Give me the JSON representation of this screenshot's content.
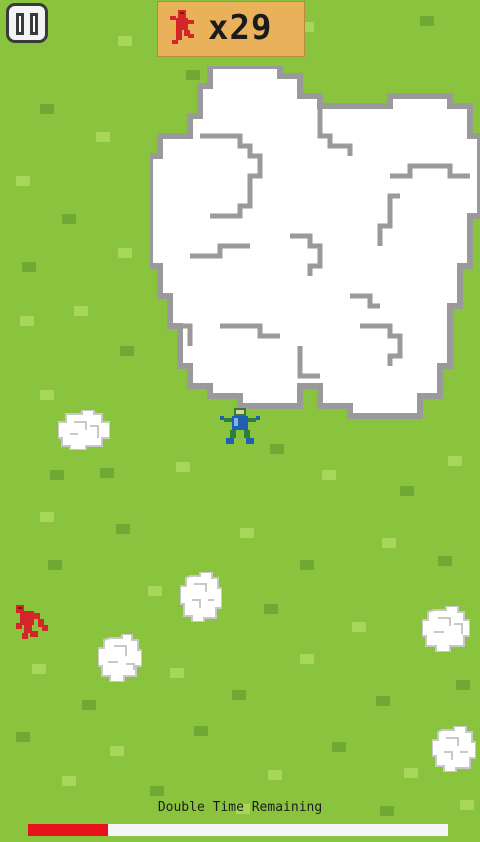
{
  "hud": {
    "counter_text": "x29",
    "counter_icon": "red-runner-icon",
    "pause_icon": "pause-icon"
  },
  "timer": {
    "label": "Double Time Remaining",
    "fraction_remaining": 0.19,
    "fill_color": "#e8121b",
    "track_color": "#f5f5f5"
  },
  "colors": {
    "grass": "#8ac43e",
    "grass_light": "#a6d65a",
    "grass_dark": "#6fa832",
    "counter_bg": "#e8b15a",
    "cloud_fill": "#ffffff",
    "cloud_outline": "#9a9a9a",
    "player": "#1f5fb0",
    "enemy": "#d3262a"
  }
}
